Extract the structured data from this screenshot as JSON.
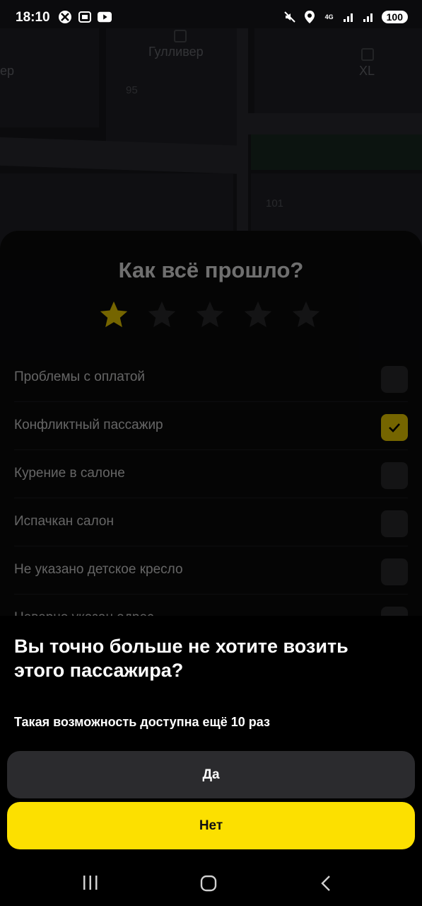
{
  "status_bar": {
    "time": "18:10",
    "battery": "100"
  },
  "map": {
    "labels": [
      "Гулливер",
      "XL",
      "ер"
    ],
    "numbers": [
      "95",
      "101"
    ]
  },
  "rating": {
    "title": "Как всё прошло?",
    "stars_selected": 1,
    "stars_total": 5,
    "star_color_active": "#f5d300",
    "star_color_inactive": "#2a2a2c"
  },
  "options": [
    {
      "label": "Проблемы с оплатой",
      "checked": false
    },
    {
      "label": "Конфликтный пассажир",
      "checked": true
    },
    {
      "label": "Курение в салоне",
      "checked": false
    },
    {
      "label": "Испачкан салон",
      "checked": false
    },
    {
      "label": "Не указано детское кресло",
      "checked": false
    },
    {
      "label": "Неверно указан адрес",
      "checked": false
    }
  ],
  "dialog": {
    "question": "Вы точно больше не хотите возить этого пассажира?",
    "subtitle": "Такая возможность доступна ещё 10 раз",
    "yes_label": "Да",
    "no_label": "Нет"
  },
  "colors": {
    "accent": "#fce000",
    "secondary_button": "#2b2b2e"
  }
}
